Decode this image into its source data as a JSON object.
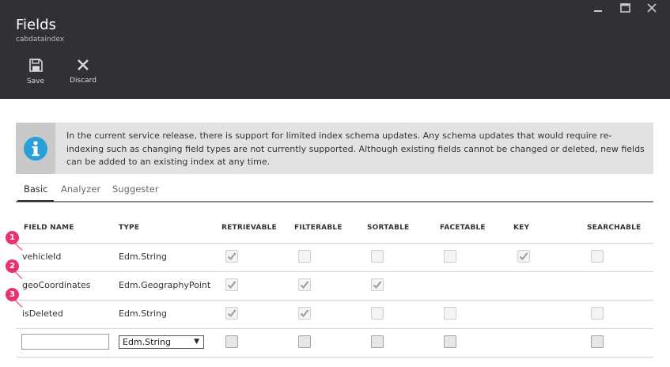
{
  "window": {
    "title": "Fields",
    "subtitle": "cabdataindex",
    "minimize_glyph": "—",
    "maximize_glyph": "☐",
    "close_glyph": "✕"
  },
  "toolbar": {
    "save_label": "Save",
    "save_icon": "save-icon",
    "discard_label": "Discard",
    "discard_icon": "discard-icon"
  },
  "info": {
    "icon": "info-icon",
    "text": "In the current service release, there is support for limited index schema updates. Any schema updates that would require re-indexing such as changing field types are not currently supported. Although existing fields cannot be changed or deleted, new fields can be added to an existing index at any time."
  },
  "tabs": [
    {
      "label": "Basic",
      "active": true
    },
    {
      "label": "Analyzer",
      "active": false
    },
    {
      "label": "Suggester",
      "active": false
    }
  ],
  "columns": [
    "FIELD NAME",
    "TYPE",
    "RETRIEVABLE",
    "FILTERABLE",
    "SORTABLE",
    "FACETABLE",
    "KEY",
    "SEARCHABLE"
  ],
  "rows": [
    {
      "badge": "1",
      "name": "vehicleId",
      "type": "Edm.String",
      "checks": {
        "retrievable": "checked",
        "filterable": "empty",
        "sortable": "empty",
        "facetable": "empty",
        "key": "checked",
        "searchable": "empty"
      }
    },
    {
      "badge": "2",
      "name": "geoCoordinates",
      "type": "Edm.GeographyPoint",
      "checks": {
        "retrievable": "checked",
        "filterable": "checked",
        "sortable": "checked",
        "facetable": "none",
        "key": "none",
        "searchable": "none"
      }
    },
    {
      "badge": "3",
      "name": "isDeleted",
      "type": "Edm.String",
      "checks": {
        "retrievable": "checked",
        "filterable": "checked",
        "sortable": "empty",
        "facetable": "empty",
        "key": "none",
        "searchable": "empty"
      }
    }
  ],
  "new_row": {
    "name_value": "",
    "type_selected": "Edm.String",
    "arrow_glyph": "▼"
  },
  "colors": {
    "header_bg": "#2f3136",
    "badge": "#e8336f",
    "info_icon": "#2aa0d8"
  }
}
